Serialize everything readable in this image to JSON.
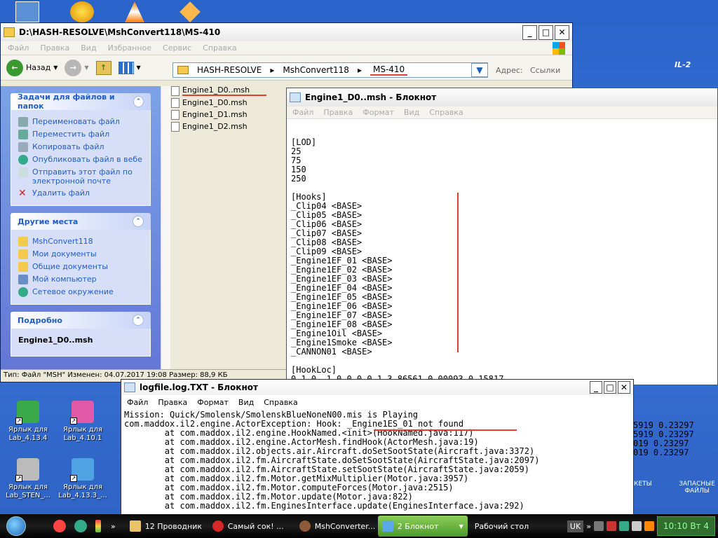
{
  "desktop": {
    "icons": [
      {
        "label": "Ярлык для Lab_4.13.4",
        "color": "#3aa94a"
      },
      {
        "label": "Ярлык для Lab_4.10.1",
        "color": "#e05aa8"
      },
      {
        "label": "Ярлык для Lab_STEN_...",
        "color": "#bbbbbb"
      },
      {
        "label": "Ярлык для Lab_4.13.3_...",
        "color": "#4fa3e3"
      }
    ],
    "right_labels": [
      "КЕТЫ",
      "ЗАПАСНЫЕ ФАЙЛЫ"
    ],
    "game_logo": "IL-2"
  },
  "explorer": {
    "title": "D:\\HASH-RESOLVE\\MshConvert118\\MS-410",
    "menu": [
      "Файл",
      "Правка",
      "Вид",
      "Избранное",
      "Сервис",
      "Справка"
    ],
    "toolbar": {
      "back": "Назад"
    },
    "address": {
      "parts": [
        "HASH-RESOLVE",
        "MshConvert118",
        "MS-410"
      ],
      "label": "Адрес:",
      "links": "Ссылки"
    },
    "tasks_panel": {
      "title": "Задачи для файлов и папок",
      "items": [
        "Переименовать файл",
        "Переместить файл",
        "Копировать файл",
        "Опубликовать файл в вебе",
        "Отправить этот файл по электронной почте",
        "Удалить файл"
      ]
    },
    "places_panel": {
      "title": "Другие места",
      "items": [
        "MshConvert118",
        "Мои документы",
        "Общие документы",
        "Мой компьютер",
        "Сетевое окружение"
      ]
    },
    "details_panel": {
      "title": "Подробно",
      "file_name": "Engine1_D0..msh"
    },
    "files": [
      "Engine1_D0..msh",
      "Engine1_D0.msh",
      "Engine1_D1.msh",
      "Engine1_D2.msh"
    ],
    "status": "Тип: Файл \"MSH\" Изменен: 04.07.2017 19:08 Размер: 88,9 КБ"
  },
  "notepad_msh": {
    "title": "Engine1_D0..msh - Блокнот",
    "menu": [
      "Файл",
      "Правка",
      "Формат",
      "Вид",
      "Справка"
    ],
    "lines": [
      "",
      "[LOD]",
      "25",
      "75",
      "150",
      "250",
      "",
      "[Hooks]",
      "_Clip04 <BASE>",
      "_Clip05 <BASE>",
      "_Clip06 <BASE>",
      "_Clip07 <BASE>",
      "_Clip08 <BASE>",
      "_Clip09 <BASE>",
      "_Engine1EF_01 <BASE>",
      "_Engine1EF_02 <BASE>",
      "_Engine1EF_03 <BASE>",
      "_Engine1EF_04 <BASE>",
      "_Engine1EF_05 <BASE>",
      "_Engine1EF_06 <BASE>",
      "_Engine1EF_07 <BASE>",
      "_Engine1EF_08 <BASE>",
      "_Engine1Oil <BASE>",
      "_Engine1Smoke <BASE>",
      "_CANNON01 <BASE>",
      "",
      "[HookLoc]",
      "0 1 0 -1 0 0 0 0 1 3.86561 0.00093 0.15817"
    ],
    "right_numbers": [
      "5919 0.23297",
      "5919 0.23297",
      "019 0.23297",
      "019 0.23297"
    ]
  },
  "notepad_log": {
    "title": "logfile.log.TXT - Блокнот",
    "menu": [
      "Файл",
      "Правка",
      "Формат",
      "Вид",
      "Справка"
    ],
    "lines": [
      "Mission: Quick/Smolensk/SmolenskBlueNoneN00.mis is Playing",
      "com.maddox.il2.engine.ActorException: Hook: _Engine1ES_01 not found",
      "        at com.maddox.il2.engine.HookNamed.<init>(HookNamed.java:117)",
      "        at com.maddox.il2.engine.ActorMesh.findHook(ActorMesh.java:19)",
      "        at com.maddox.il2.objects.air.Aircraft.doSetSootState(Aircraft.java:3372)",
      "        at com.maddox.il2.fm.AircraftState.doSetSootState(AircraftState.java:2097)",
      "        at com.maddox.il2.fm.AircraftState.setSootState(AircraftState.java:2059)",
      "        at com.maddox.il2.fm.Motor.getMixMultiplier(Motor.java:3957)",
      "        at com.maddox.il2.fm.Motor.computeForces(Motor.java:2515)",
      "        at com.maddox.il2.fm.Motor.update(Motor.java:822)",
      "        at com.maddox.il2.fm.EnginesInterface.update(EnginesInterface.java:292)"
    ]
  },
  "taskbar": {
    "tasks": [
      {
        "label": "12 Проводник",
        "color": "#e9c46a"
      },
      {
        "label": "Самый сок! ...",
        "color": "#d62828"
      },
      {
        "label": "MshConverter...",
        "color": "#8d5a3a"
      },
      {
        "label": "2 Блокнот",
        "color": "#5aa9e6"
      },
      {
        "label": "Рабочий стол",
        "color": "#333333"
      }
    ],
    "lang": "UK",
    "clock": "10:10 Вт 4"
  }
}
